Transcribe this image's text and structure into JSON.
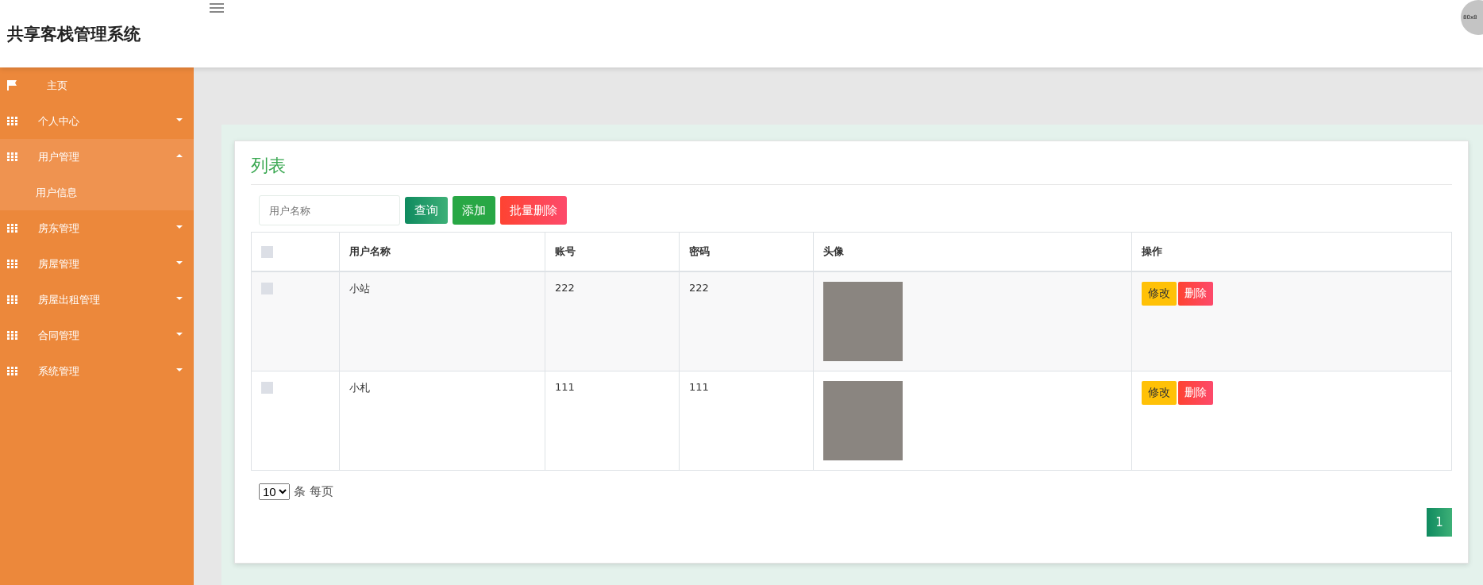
{
  "header": {
    "title": "共享客栈管理系统",
    "avatar_text": "80x8"
  },
  "sidebar": {
    "items": [
      {
        "kind": "link",
        "label": "主页"
      },
      {
        "kind": "menu",
        "label": "个人中心",
        "expanded": false
      },
      {
        "kind": "menu",
        "label": "用户管理",
        "expanded": true,
        "children": [
          {
            "label": "用户信息"
          }
        ]
      },
      {
        "kind": "menu",
        "label": "房东管理",
        "expanded": false
      },
      {
        "kind": "menu",
        "label": "房屋管理",
        "expanded": false
      },
      {
        "kind": "menu",
        "label": "房屋出租管理",
        "expanded": false
      },
      {
        "kind": "menu",
        "label": "合同管理",
        "expanded": false
      },
      {
        "kind": "menu",
        "label": "系统管理",
        "expanded": false
      }
    ]
  },
  "panel": {
    "title": "列表",
    "search": {
      "placeholder": "用户名称"
    },
    "buttons": [
      {
        "kind": "search",
        "label": "查询"
      },
      {
        "kind": "add",
        "label": "添加"
      },
      {
        "kind": "delete",
        "label": "批量删除"
      }
    ],
    "table": {
      "select_all_checked": false,
      "columns": [
        "用户名称",
        "账号",
        "密码",
        "头像",
        "操作"
      ],
      "rows": [
        {
          "checked": false,
          "name": "小站",
          "account": "222",
          "password": "222",
          "actions": [
            {
              "kind": "edit",
              "label": "修改"
            },
            {
              "kind": "delete",
              "label": "删除"
            }
          ]
        },
        {
          "checked": false,
          "name": "小札",
          "account": "111",
          "password": "111",
          "actions": [
            {
              "kind": "edit",
              "label": "修改"
            },
            {
              "kind": "delete",
              "label": "删除"
            }
          ]
        }
      ]
    },
    "page_size": "10",
    "page_size_label": "条 每页",
    "pages": [
      {
        "label": "1",
        "selected": true
      }
    ]
  }
}
